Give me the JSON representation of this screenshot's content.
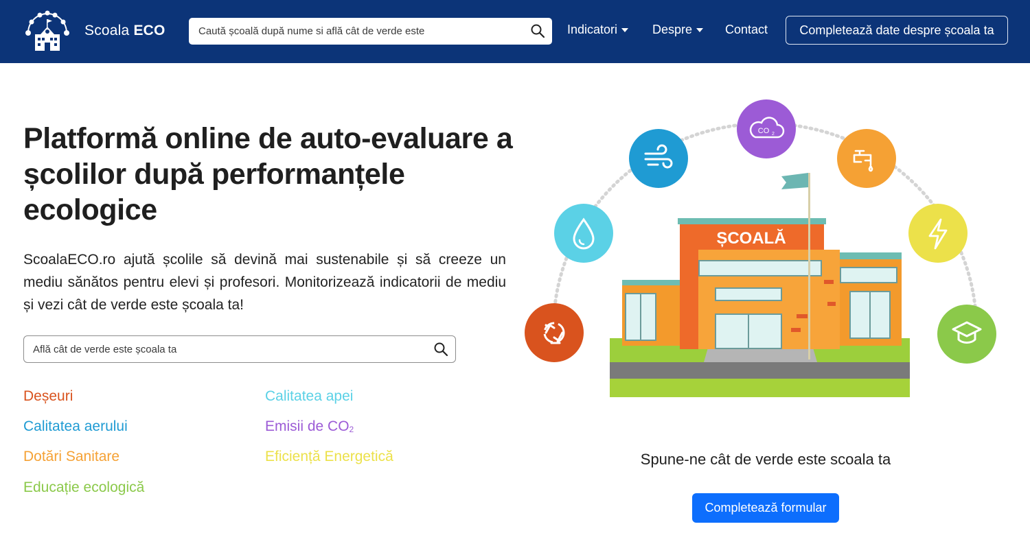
{
  "colors": {
    "navbar_bg": "#0c3478",
    "primary_button": "#0d6efd",
    "deseuri": "#d9531e",
    "aer": "#1f9bd3",
    "sanitare": "#f5a134",
    "educatie": "#8bc94a",
    "apa": "#5bd1e6",
    "co2": "#9c5bd6",
    "energie": "#ece14a"
  },
  "navbar": {
    "brand_name": "Scoala",
    "brand_bold": "ECO",
    "search_placeholder": "Caută școală după nume si află cât de verde este",
    "links": [
      {
        "label": "Indicatori",
        "dropdown": true
      },
      {
        "label": "Despre",
        "dropdown": true
      },
      {
        "label": "Contact",
        "dropdown": false
      }
    ],
    "cta_label": "Completează date despre școala ta"
  },
  "hero": {
    "title": "Platformă online de auto-evaluare a școlilor după performanțele ecologice",
    "description": "ScoalaECO.ro ajută școlile să devină mai sustenabile și să creeze un mediu sănătos pentru elevi și profesori. Monitorizează indicatorii de mediu și vezi cât de verde este școala ta!",
    "search_placeholder": "Află cât de verde este școala ta"
  },
  "indicators": {
    "deseuri": "Deșeuri",
    "aer": "Calitatea aerului",
    "sanitare": "Dotări Sanitare",
    "educatie": "Educație ecologică",
    "apa": "Calitatea apei",
    "co2_prefix": "Emisii de CO",
    "co2_sub": "2",
    "energie": "Eficiență Energetică"
  },
  "illustration": {
    "building_sign": "ȘCOALĂ",
    "co2_icon_text": "CO",
    "co2_icon_sub": "2",
    "icons": [
      "recycle-icon",
      "water-drop-icon",
      "wind-icon",
      "co2-cloud-icon",
      "faucet-icon",
      "lightning-icon",
      "graduation-cap-icon"
    ]
  },
  "cta_section": {
    "tagline": "Spune-ne cât de verde este scoala ta",
    "button_label": "Completează formular"
  }
}
